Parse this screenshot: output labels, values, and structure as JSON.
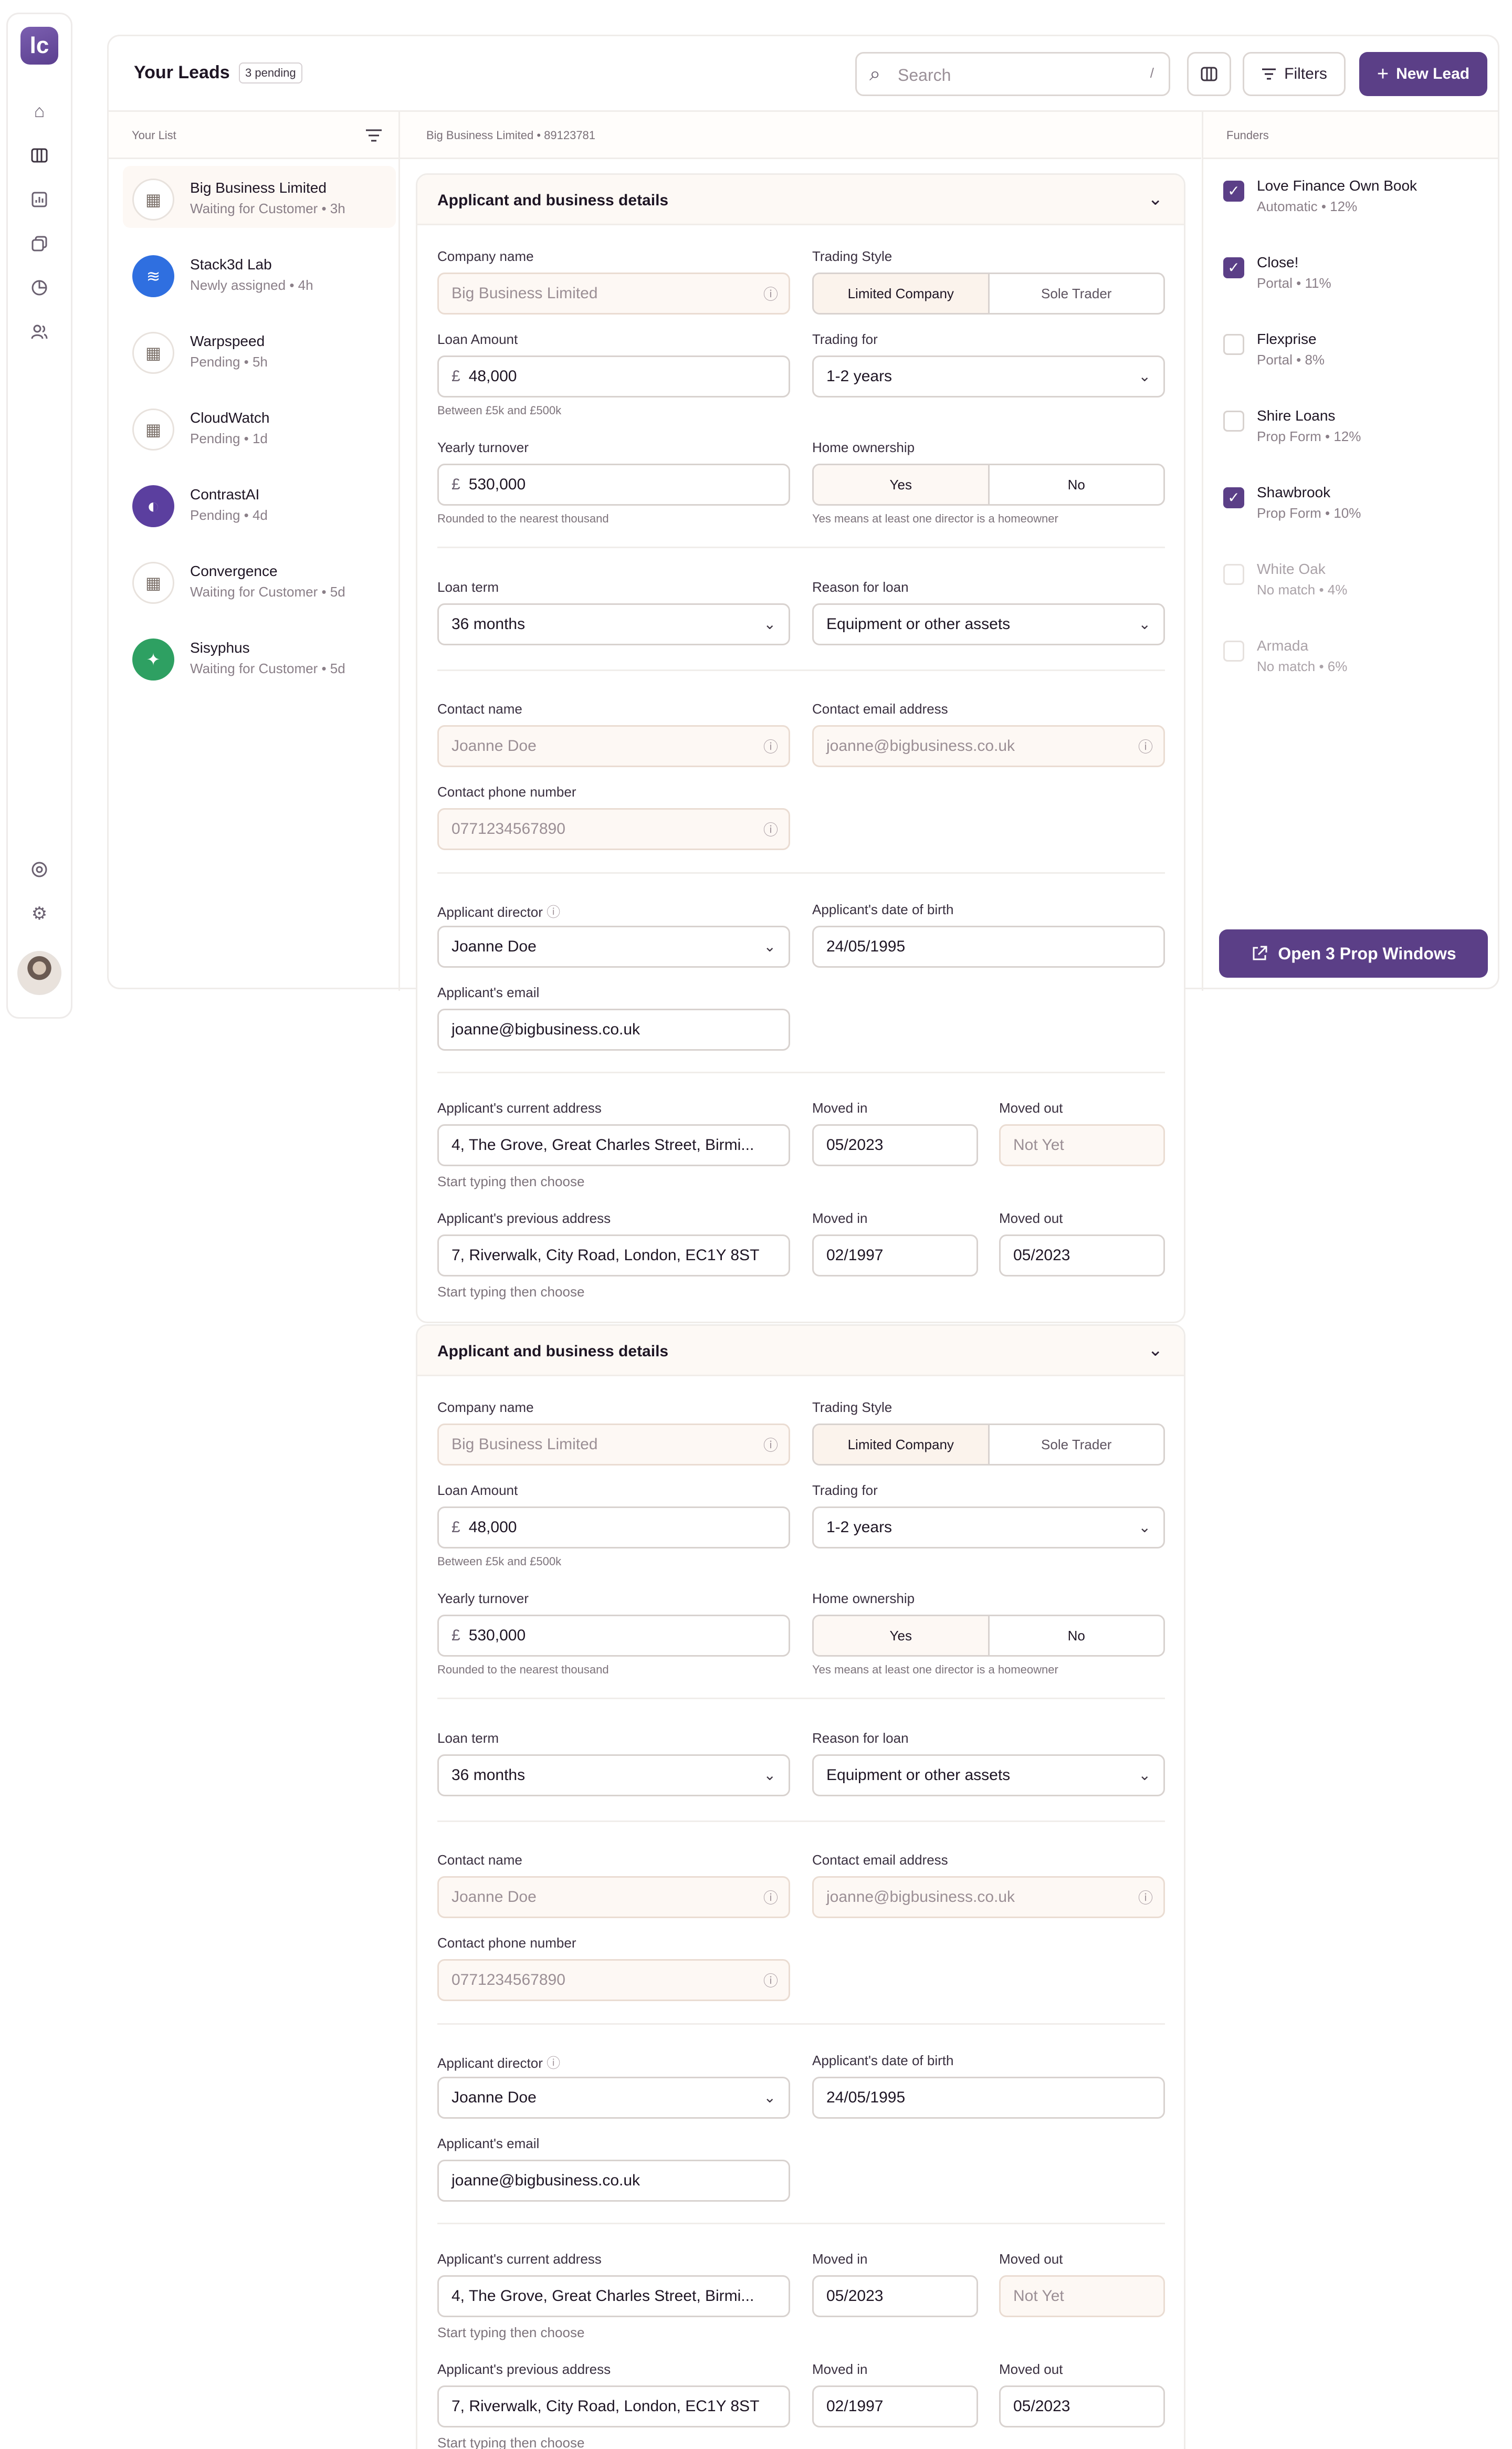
{
  "app": {
    "logo_glyph": "lc",
    "brand_color": "#5b3f87"
  },
  "sidebar": {
    "nav": [
      "home-icon",
      "columns-icon",
      "reports-icon",
      "copy-icon",
      "pie-chart-icon",
      "users-icon"
    ],
    "bottom": [
      "help-icon",
      "settings-icon"
    ]
  },
  "header": {
    "title": "Your Leads",
    "badge": "3 pending",
    "search_placeholder": "Search",
    "search_shortcut": "/",
    "filters_label": "Filters",
    "new_lead_label": "New Lead"
  },
  "list": {
    "heading": "Your List",
    "leads": [
      {
        "name": "Big Business Limited",
        "status": "Waiting for Customer  •  3h"
      },
      {
        "name": "Stack3d Lab",
        "status": "Newly assigned  •  4h"
      },
      {
        "name": "Warpspeed",
        "status": "Pending  •  5h"
      },
      {
        "name": "CloudWatch",
        "status": "Pending  •  1d"
      },
      {
        "name": "ContrastAI",
        "status": "Pending  •  4d"
      },
      {
        "name": "Convergence",
        "status": "Waiting for Customer  •  5d"
      },
      {
        "name": "Sisyphus",
        "status": "Waiting for Customer  •  5d"
      }
    ]
  },
  "detail": {
    "breadcrumb": "Big Business Limited  •  89123781",
    "sections": [
      {
        "title": "Applicant and business details",
        "company_label": "Company name",
        "company_value": "Big Business Limited",
        "trading_style_label": "Trading Style",
        "trading_style_opts": [
          "Limited Company",
          "Sole Trader"
        ],
        "loan_label": "Loan Amount",
        "loan_currency": "£",
        "loan_value": "48,000",
        "loan_hint": "Between £5k and £500k",
        "trading_for_label": "Trading for",
        "trading_for_value": "1-2 years",
        "turnover_label": "Yearly turnover",
        "turnover_currency": "£",
        "turnover_value": "530,000",
        "turnover_hint": "Rounded to the nearest thousand",
        "home_label": "Home ownership",
        "home_opts": [
          "Yes",
          "No"
        ],
        "home_hint": "Yes means at least one director is a homeowner",
        "term_label": "Loan term",
        "term_value": "36 months",
        "reason_label": "Reason for loan",
        "reason_value": "Equipment or other assets",
        "contact_name_label": "Contact name",
        "contact_name_value": "Joanne Doe",
        "contact_email_label": "Contact email address",
        "contact_email_value": "joanne@bigbusiness.co.uk",
        "contact_phone_label": "Contact phone number",
        "contact_phone_value": "0771234567890",
        "director_label": "Applicant director",
        "director_value": "Joanne Doe",
        "dob_label": "Applicant's date of birth",
        "dob_value": "24/05/1995",
        "app_email_label": "Applicant's email",
        "app_email_value": "joanne@bigbusiness.co.uk",
        "cur_addr_label": "Applicant's current address",
        "cur_addr_value": "4, The Grove, Great Charles Street, Birmi...",
        "moved_in_label": "Moved in",
        "moved_out_label": "Moved out",
        "cur_in": "05/2023",
        "cur_out": "Not Yet",
        "addr_hint": "Start typing then choose",
        "prev_addr_label": "Applicant's previous address",
        "prev_addr_value": "7, Riverwalk, City Road, London, EC1Y 8ST",
        "prev_in": "02/1997",
        "prev_out": "05/2023"
      },
      {
        "title": "Applicant and business details",
        "company_label": "Company name",
        "company_value": "Big Business Limited",
        "trading_style_label": "Trading Style",
        "trading_style_opts": [
          "Limited Company",
          "Sole Trader"
        ],
        "loan_label": "Loan Amount",
        "loan_currency": "£",
        "loan_value": "48,000",
        "loan_hint": "Between £5k and £500k",
        "trading_for_label": "Trading for",
        "trading_for_value": "1-2 years",
        "turnover_label": "Yearly turnover",
        "turnover_currency": "£",
        "turnover_value": "530,000",
        "turnover_hint": "Rounded to the nearest thousand",
        "home_label": "Home ownership",
        "home_opts": [
          "Yes",
          "No"
        ],
        "home_hint": "Yes means at least one director is a homeowner",
        "term_label": "Loan term",
        "term_value": "36 months",
        "reason_label": "Reason for loan",
        "reason_value": "Equipment or other assets",
        "contact_name_label": "Contact name",
        "contact_name_value": "Joanne Doe",
        "contact_email_label": "Contact email address",
        "contact_email_value": "joanne@bigbusiness.co.uk",
        "contact_phone_label": "Contact phone number",
        "contact_phone_value": "0771234567890",
        "director_label": "Applicant director",
        "director_value": "Joanne Doe",
        "dob_label": "Applicant's date of birth",
        "dob_value": "24/05/1995",
        "app_email_label": "Applicant's email",
        "app_email_value": "joanne@bigbusiness.co.uk",
        "cur_addr_label": "Applicant's current address",
        "cur_addr_value": "4, The Grove, Great Charles Street, Birmi...",
        "moved_in_label": "Moved in",
        "moved_out_label": "Moved out",
        "cur_in": "05/2023",
        "cur_out": "Not Yet",
        "addr_hint": "Start typing then choose",
        "prev_addr_label": "Applicant's previous address",
        "prev_addr_value": "7, Riverwalk, City Road, London, EC1Y 8ST",
        "prev_in": "02/1997",
        "prev_out": "05/2023"
      }
    ]
  },
  "funders": {
    "heading": "Funders",
    "items": [
      {
        "name": "Love Finance Own Book",
        "sub": "Automatic  •  12%",
        "checked": true
      },
      {
        "name": "Close!",
        "sub": "Portal  •  11%",
        "checked": true
      },
      {
        "name": "Flexprise",
        "sub": "Portal  •  8%",
        "checked": false
      },
      {
        "name": "Shire Loans",
        "sub": "Prop Form  •  12%",
        "checked": false
      },
      {
        "name": "Shawbrook",
        "sub": "Prop Form  •  10%",
        "checked": true
      },
      {
        "name": "White Oak",
        "sub": "No match  •  4%",
        "checked": false
      },
      {
        "name": "Armada",
        "sub": "No match  •  6%",
        "checked": false
      }
    ],
    "open_button": "Open 3 Prop Windows"
  }
}
